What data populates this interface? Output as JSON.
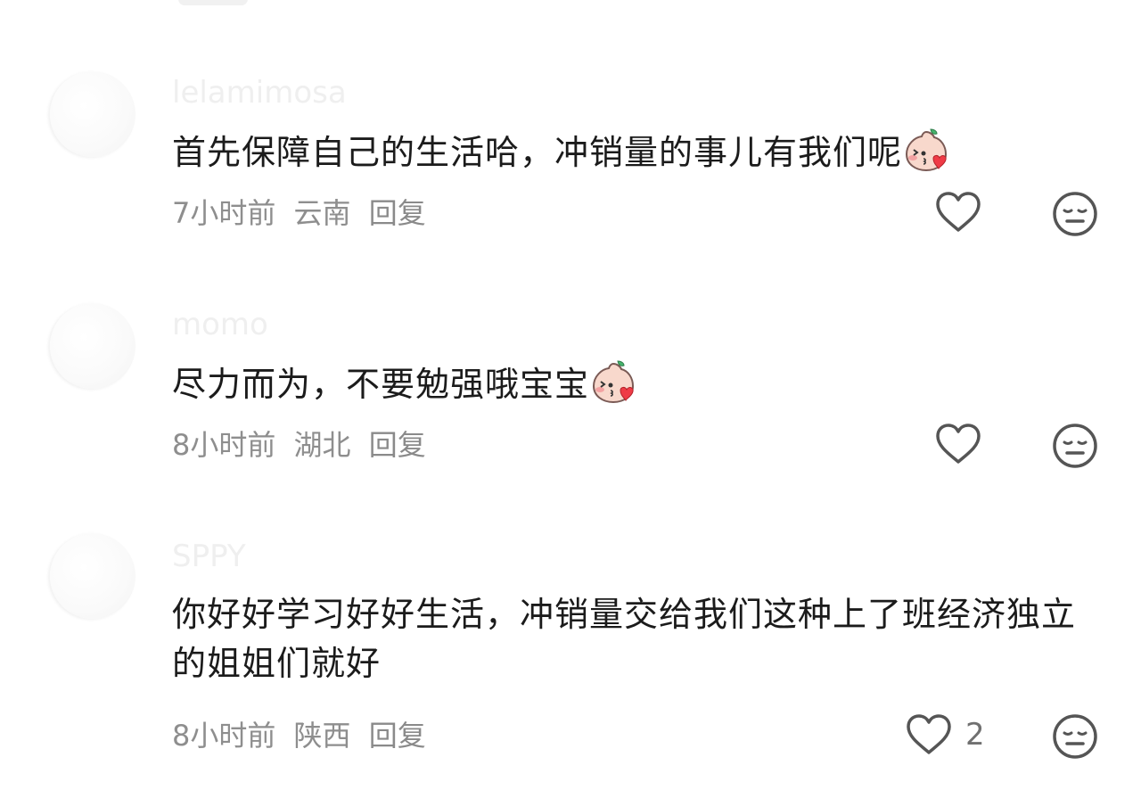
{
  "colors": {
    "text": "#1b1b1b",
    "meta": "#8e8e8e",
    "icon": "#555555",
    "username": "#efefef"
  },
  "comments": [
    {
      "username": "lelamimosa",
      "text": "首先保障自己的生活哈，冲销量的事儿有我们呢",
      "emoji": "blush-peach-emoji",
      "time": "7小时前",
      "location": "云南",
      "reply_label": "回复",
      "like_count": ""
    },
    {
      "username": "momo",
      "text": "尽力而为，不要勉强哦宝宝",
      "emoji": "blush-peach-emoji",
      "time": "8小时前",
      "location": "湖北",
      "reply_label": "回复",
      "like_count": ""
    },
    {
      "username": "SPPY",
      "text": "你好好学习好好生活，冲销量交给我们这种上了班经济独立的姐姐们就好",
      "emoji": "",
      "time": "8小时前",
      "location": "陕西",
      "reply_label": "回复",
      "like_count": "2"
    }
  ]
}
